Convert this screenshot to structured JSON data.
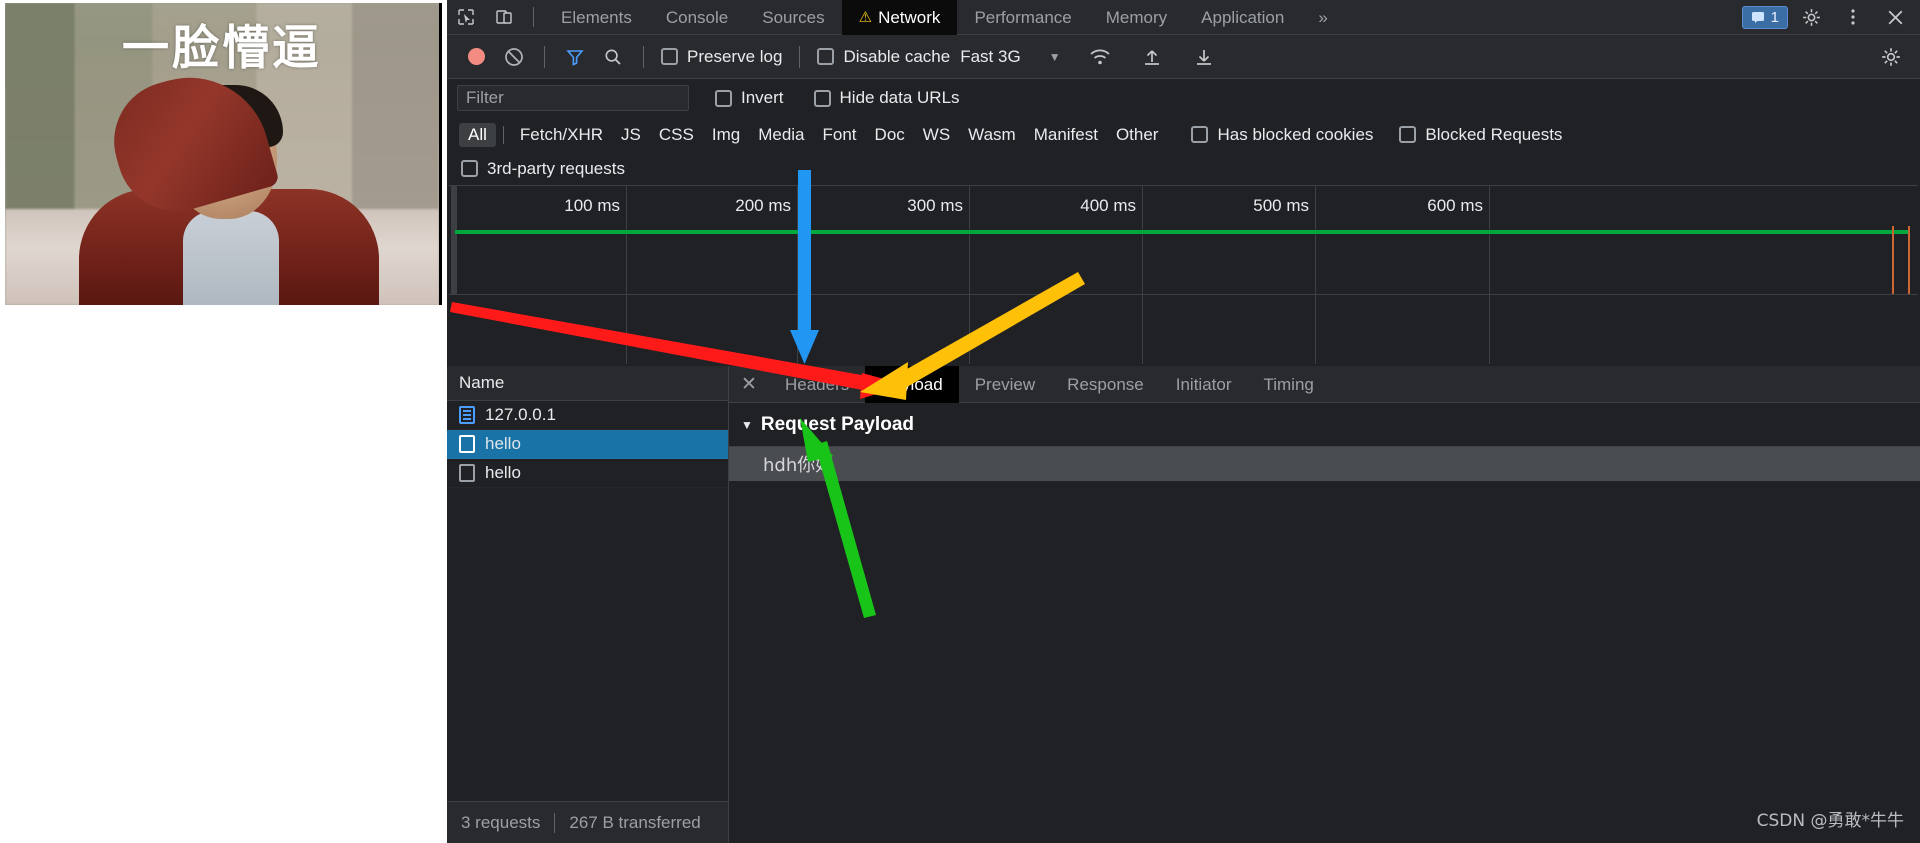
{
  "photo": {
    "caption": "一脸懵逼"
  },
  "tabbar": {
    "inspect_icon": "inspect-cursor-icon",
    "device_icon": "device-toolbar-icon",
    "tabs": [
      {
        "label": "Elements",
        "active": false,
        "warn": false
      },
      {
        "label": "Console",
        "active": false,
        "warn": false
      },
      {
        "label": "Sources",
        "active": false,
        "warn": false
      },
      {
        "label": "Network",
        "active": true,
        "warn": true
      },
      {
        "label": "Performance",
        "active": false,
        "warn": false
      },
      {
        "label": "Memory",
        "active": false,
        "warn": false
      },
      {
        "label": "Application",
        "active": false,
        "warn": false
      }
    ],
    "more_label": "»",
    "issues_count": "1",
    "issues_icon": "message-icon",
    "settings_icon": "gear-icon",
    "kebab_icon": "more-vertical-icon",
    "close_icon": "close-icon"
  },
  "nettool": {
    "record_icon": "record-stop-icon",
    "clear_icon": "clear-no-entry-icon",
    "filter_icon": "funnel-icon",
    "search_icon": "search-icon",
    "preserve_log": "Preserve log",
    "disable_cache": "Disable cache",
    "throttle_value": "Fast 3G",
    "caret_icon": "chevron-down-icon",
    "wifi_icon": "network-conditions-icon",
    "import_icon": "upload-arrow-icon",
    "export_icon": "download-arrow-icon",
    "settings_icon": "gear-icon"
  },
  "filterrow": {
    "placeholder": "Filter",
    "value": "",
    "invert": "Invert",
    "hide_data_urls": "Hide data URLs"
  },
  "types": [
    "All",
    "Fetch/XHR",
    "JS",
    "CSS",
    "Img",
    "Media",
    "Font",
    "Doc",
    "WS",
    "Wasm",
    "Manifest",
    "Other"
  ],
  "active_type": "All",
  "checkboxes": {
    "has_blocked_cookies": "Has blocked cookies",
    "blocked_requests": "Blocked Requests",
    "third_party_requests": "3rd-party requests"
  },
  "overview": {
    "ticks": [
      "100 ms",
      "200 ms",
      "300 ms",
      "400 ms",
      "500 ms",
      "600 ms"
    ],
    "bar_color": "#00a83e",
    "marker_color": "#1f9bff"
  },
  "requests": {
    "column_header": "Name",
    "rows": [
      {
        "name": "127.0.0.1",
        "icon": "document-icon",
        "selected": false
      },
      {
        "name": "hello",
        "icon": "websocket-icon",
        "selected": true
      },
      {
        "name": "hello",
        "icon": "websocket-icon",
        "selected": false
      }
    ]
  },
  "status": {
    "requests": "3 requests",
    "transferred": "267 B transferred"
  },
  "detail": {
    "close_icon": "close-icon",
    "tabs": [
      {
        "label": "Headers",
        "active": false
      },
      {
        "label": "Payload",
        "active": true
      },
      {
        "label": "Preview",
        "active": false
      },
      {
        "label": "Response",
        "active": false
      },
      {
        "label": "Initiator",
        "active": false
      },
      {
        "label": "Timing",
        "active": false
      }
    ],
    "section_title": "Request Payload",
    "payload_value": "hdh你好"
  },
  "watermark": "CSDN @勇敢*牛牛",
  "annotations": {
    "red_arrow": "#ff1a1a",
    "blue_arrow": "#2196f3",
    "yellow_arrow": "#ffc107",
    "green_arrow": "#19c419"
  }
}
